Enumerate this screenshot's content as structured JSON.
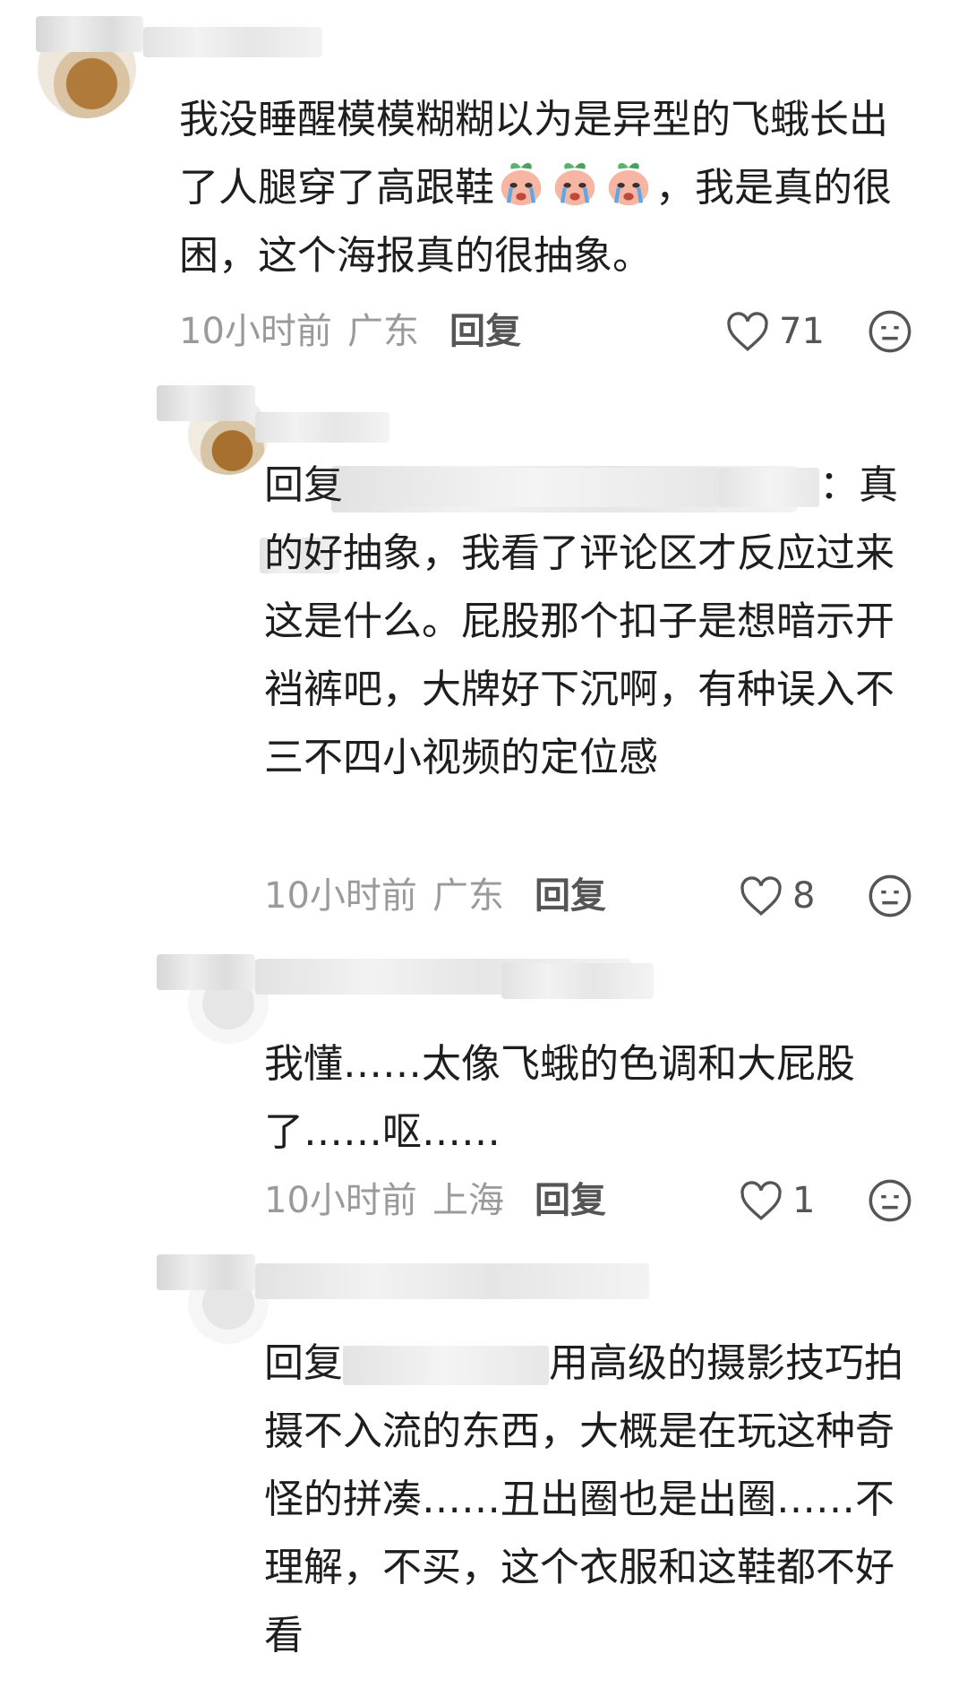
{
  "comments": [
    {
      "text_before_emoji": "我没睡醒模模糊糊以为是异型的飞蛾长出了人腿穿了高跟鞋",
      "emoji_icon": "crying-peach-emoji",
      "text_after_emoji": "，我是真的很困，这个海报真的很抽象。",
      "time": "10小时前",
      "location": "广东",
      "reply_label": "回复",
      "likes": "71"
    },
    {
      "prefix": "回复",
      "text": "：真的好抽象，我看了评论区才反应过来这是什么。屁股那个扣子是想暗示开裆裤吧，大牌好下沉啊，有种误入不三不四小视频的定位感",
      "time": "10小时前",
      "location": "广东",
      "reply_label": "回复",
      "likes": "8"
    },
    {
      "text": "我懂……太像飞蛾的色调和大屁股了……呕……",
      "time": "10小时前",
      "location": "上海",
      "reply_label": "回复",
      "likes": "1"
    },
    {
      "prefix": "回复",
      "text": "用高级的摄影技巧拍摄不入流的东西，大概是在玩这种奇怪的拼凑……丑出圈也是出圈……不理解，不买，这个衣服和这鞋都不好看"
    }
  ],
  "colors": {
    "meta": "#9a9a9a",
    "text": "#1e1e1e",
    "action": "#555555"
  }
}
